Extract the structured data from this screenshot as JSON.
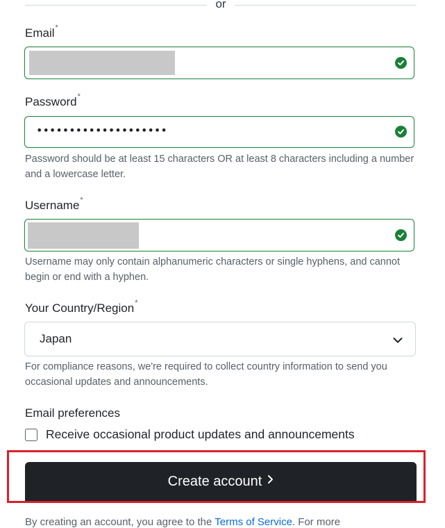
{
  "divider": {
    "text": "or"
  },
  "email": {
    "label": "Email",
    "required_mark": "*"
  },
  "password": {
    "label": "Password",
    "required_mark": "*",
    "masked_value": "••••••••••••••••••••",
    "hint": "Password should be at least 15 characters OR at least 8 characters including a number and a lowercase letter."
  },
  "username": {
    "label": "Username",
    "required_mark": "*",
    "hint": "Username may only contain alphanumeric characters or single hyphens, and cannot begin or end with a hyphen."
  },
  "country": {
    "label": "Your Country/Region",
    "required_mark": "*",
    "selected": "Japan",
    "hint": "For compliance reasons, we're required to collect country information to send you occasional updates and announcements."
  },
  "preferences": {
    "title": "Email preferences",
    "checkbox_label": "Receive occasional product updates and announcements",
    "checked": false
  },
  "submit": {
    "label": "Create account"
  },
  "footer": {
    "prefix": "By creating an account, you agree to the ",
    "terms_link": "Terms of Service",
    "suffix": ". For more"
  },
  "colors": {
    "valid_green": "#1a7f37",
    "button_dark": "#1f2328",
    "highlight_red": "#d9202a",
    "link_blue": "#0969da"
  },
  "icons": [
    "check-circle-icon",
    "chevron-down-icon",
    "chevron-right-icon"
  ]
}
